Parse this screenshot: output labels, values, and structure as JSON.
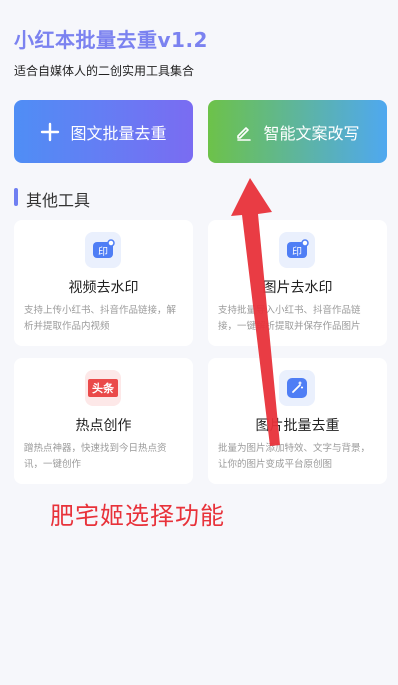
{
  "app": {
    "title": "小红本批量去重v1.2",
    "subtitle": "适合自媒体人的二创实用工具集合"
  },
  "primary_actions": [
    {
      "label": "图文批量去重",
      "icon": "plus-icon"
    },
    {
      "label": "智能文案改写",
      "icon": "pencil-icon"
    }
  ],
  "section": {
    "title": "其他工具"
  },
  "tools": [
    {
      "title": "视频去水印",
      "desc": "支持上传小红书、抖音作品链接，解析并提取作品内视频",
      "icon": "watermark-icon"
    },
    {
      "title": "图片去水印",
      "desc": "支持批量导入小红书、抖音作品链接，一键解析提取并保存作品图片",
      "icon": "watermark-icon"
    },
    {
      "title": "热点创作",
      "desc": "蹭热点神器，快速找到今日热点资讯，一键创作",
      "icon": "toutiao-icon",
      "icon_text": "头条"
    },
    {
      "title": "图片批量去重",
      "desc": "批量为图片添加特效、文字与背景，让你的图片变成平台原创图",
      "icon": "magic-wand-icon"
    }
  ],
  "annotation": {
    "text": "肥宅姬选择功能",
    "color": "#e8323a"
  },
  "colors": {
    "accent": "#7b82f0",
    "arrow": "#e8323a"
  }
}
